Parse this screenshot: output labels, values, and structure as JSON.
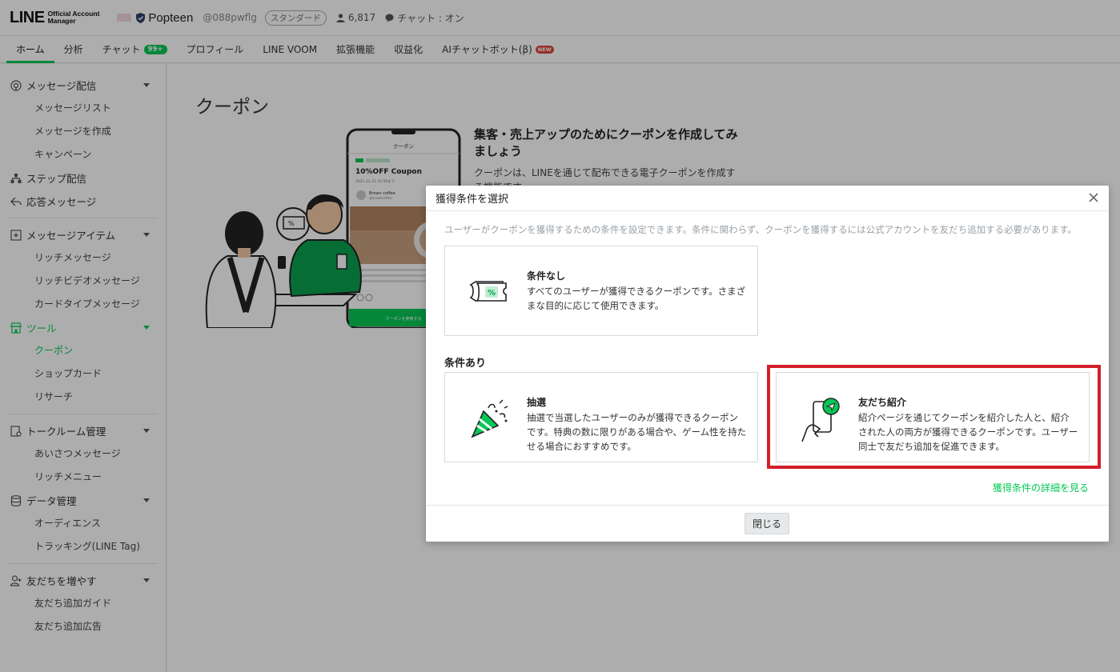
{
  "header": {
    "logo_line": "LINE",
    "logo_sub_1": "Official Account",
    "logo_sub_2": "Manager",
    "account_name": "Popteen",
    "account_id": "@088pwflg",
    "plan": "スタンダード",
    "friends_count": "6,817",
    "chat_status": "チャット : オン"
  },
  "nav": {
    "tabs": [
      {
        "label": "ホーム"
      },
      {
        "label": "分析"
      },
      {
        "label": "チャット",
        "badge": "99+"
      },
      {
        "label": "プロフィール"
      },
      {
        "label": "LINE VOOM"
      },
      {
        "label": "拡張機能"
      },
      {
        "label": "収益化"
      },
      {
        "label": "AIチャットボット(β)",
        "badge": "NEW"
      }
    ]
  },
  "sidebar": {
    "sections": [
      {
        "label": "メッセージ配信",
        "items": [
          "メッセージリスト",
          "メッセージを作成",
          "キャンペーン"
        ]
      },
      {
        "label": "ステップ配信"
      },
      {
        "label": "応答メッセージ"
      },
      {
        "label": "メッセージアイテム",
        "items": [
          "リッチメッセージ",
          "リッチビデオメッセージ",
          "カードタイプメッセージ"
        ]
      },
      {
        "label": "ツール",
        "items": [
          "クーポン",
          "ショップカード",
          "リサーチ"
        ]
      },
      {
        "label": "トークルーム管理",
        "items": [
          "あいさつメッセージ",
          "リッチメニュー"
        ]
      },
      {
        "label": "データ管理",
        "items": [
          "オーディエンス",
          "トラッキング(LINE Tag)"
        ]
      },
      {
        "label": "友だちを増やす",
        "items": [
          "友だち追加ガイド",
          "友だち追加広告"
        ]
      }
    ]
  },
  "main": {
    "title": "クーポン",
    "promo_title": "集客・売上アップのためにクーポンを作成してみましょう",
    "promo_text": "クーポンは、LINEを通じて配布できる電子クーポンを作成する機能です。",
    "phone": {
      "header": "クーポン",
      "coupon_title": "10%OFF Coupon",
      "coupon_date": "2021.12.31 23:59まで",
      "shop_name": "Brown coffee",
      "shop_id": "@browncoffee",
      "button": "クーポンを使用する"
    }
  },
  "modal": {
    "title": "獲得条件を選択",
    "description": "ユーザーがクーポンを獲得するための条件を設定できます。条件に関わらず、クーポンを獲得するには公式アカウントを友だち追加する必要があります。",
    "no_condition": {
      "title": "条件なし",
      "desc": "すべてのユーザーが獲得できるクーポンです。さまざまな目的に応じて使用できます。"
    },
    "with_condition_label": "条件あり",
    "lottery": {
      "title": "抽選",
      "desc": "抽選で当選したユーザーのみが獲得できるクーポンです。特典の数に限りがある場合や、ゲーム性を持たせる場合におすすめです。"
    },
    "referral": {
      "title": "友だち紹介",
      "desc": "紹介ページを通じてクーポンを紹介した人と、紹介された人の両方が獲得できるクーポンです。ユーザー同士で友だち追加を促進できます。"
    },
    "detail_link": "獲得条件の詳細を見る",
    "close_button": "閉じる"
  },
  "colors": {
    "brand_green": "#06c755",
    "highlight_red": "#d21f2a",
    "badge_new": "#e0443c"
  }
}
